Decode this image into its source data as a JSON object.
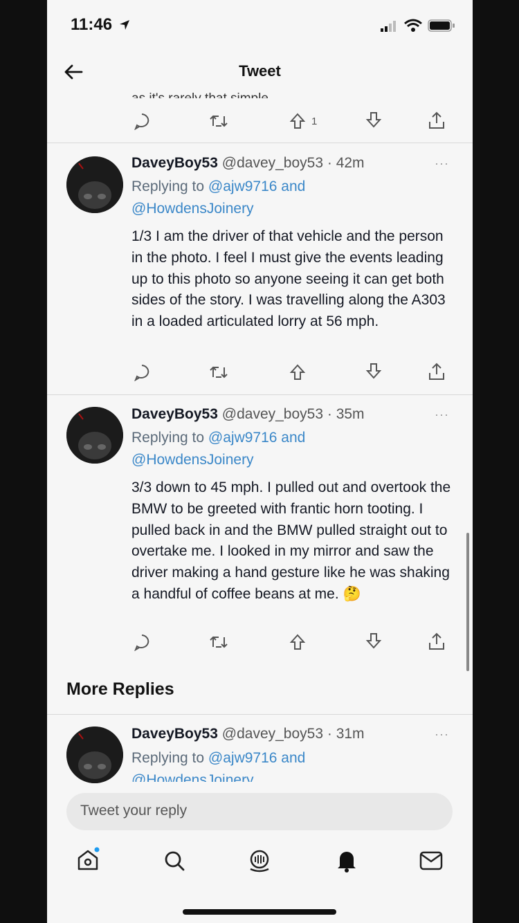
{
  "status_bar": {
    "time": "11:46"
  },
  "header": {
    "title": "Tweet"
  },
  "top_tweet": {
    "cut_text": "as it's rarely that simple.",
    "like_count": "1"
  },
  "tweets": [
    {
      "display_name": "DaveyBoy53",
      "handle": "@davey_boy53",
      "time": "· 42m",
      "reply_prefix": "Replying to",
      "reply_to_1": "@ajw9716",
      "reply_and": "and",
      "reply_to_2": "@HowdensJoinery",
      "text": "1/3 I am the driver of that vehicle and the person in the photo. I feel I must give the events leading up to this photo so anyone seeing it can get both sides of the story. I was travelling along the A303 in a loaded articulated lorry at 56 mph."
    },
    {
      "display_name": "DaveyBoy53",
      "handle": "@davey_boy53",
      "time": "· 35m",
      "reply_prefix": "Replying to",
      "reply_to_1": "@ajw9716",
      "reply_and": "and",
      "reply_to_2": "@HowdensJoinery",
      "text": "3/3 down to 45 mph. I pulled out and overtook the BMW to be greeted with frantic horn tooting. I pulled back in and the BMW pulled straight out to overtake me. I looked in my mirror and saw the driver making a hand gesture like he was shaking a handful of coffee beans at me.",
      "emoji": "🤔"
    }
  ],
  "more_replies": {
    "heading": "More Replies",
    "tweet": {
      "display_name": "DaveyBoy53",
      "handle": "@davey_boy53",
      "time": "· 31m",
      "reply_prefix": "Replying to",
      "reply_to_1": "@ajw9716",
      "reply_and": "and",
      "reply_to_2": "@HowdensJoinery"
    }
  },
  "composer": {
    "placeholder": "Tweet your reply"
  },
  "more_dots": "···",
  "icons": {
    "back": "back-arrow-icon",
    "reply": "reply-icon",
    "retweet": "retweet-icon",
    "upvote": "upvote-icon",
    "downvote": "downvote-icon",
    "share": "share-icon",
    "home": "home-icon",
    "search": "search-icon",
    "spaces": "spaces-icon",
    "notifications": "bell-icon",
    "messages": "mail-icon"
  },
  "colors": {
    "link": "#3a87c8",
    "background": "#f6f6f6",
    "notification_dot": "#1d9bf0"
  }
}
